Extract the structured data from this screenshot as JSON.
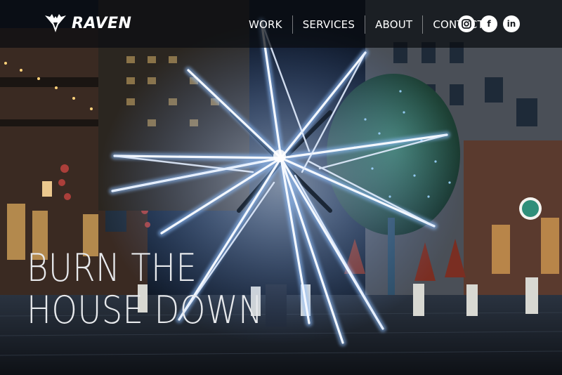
{
  "brand": {
    "name": "RAVEN",
    "logo_icon": "raven-wings-icon"
  },
  "nav": {
    "items": [
      {
        "label": "WORK"
      },
      {
        "label": "SERVICES"
      },
      {
        "label": "ABOUT"
      },
      {
        "label": "CONTACT"
      }
    ]
  },
  "social": {
    "items": [
      {
        "icon": "instagram-icon"
      },
      {
        "icon": "facebook-icon",
        "glyph": "f"
      },
      {
        "icon": "linkedin-icon",
        "glyph": "in"
      }
    ]
  },
  "hero": {
    "headline_line1": "BURN THE",
    "headline_line2": "HOUSE DOWN",
    "scene": "illuminated-star-sculpture-photo"
  },
  "colors": {
    "nav_bar": "#0a0c10",
    "text": "#ffffff",
    "star_glow": "#cfe2ff",
    "accent_sign": "#2f8f7a"
  }
}
